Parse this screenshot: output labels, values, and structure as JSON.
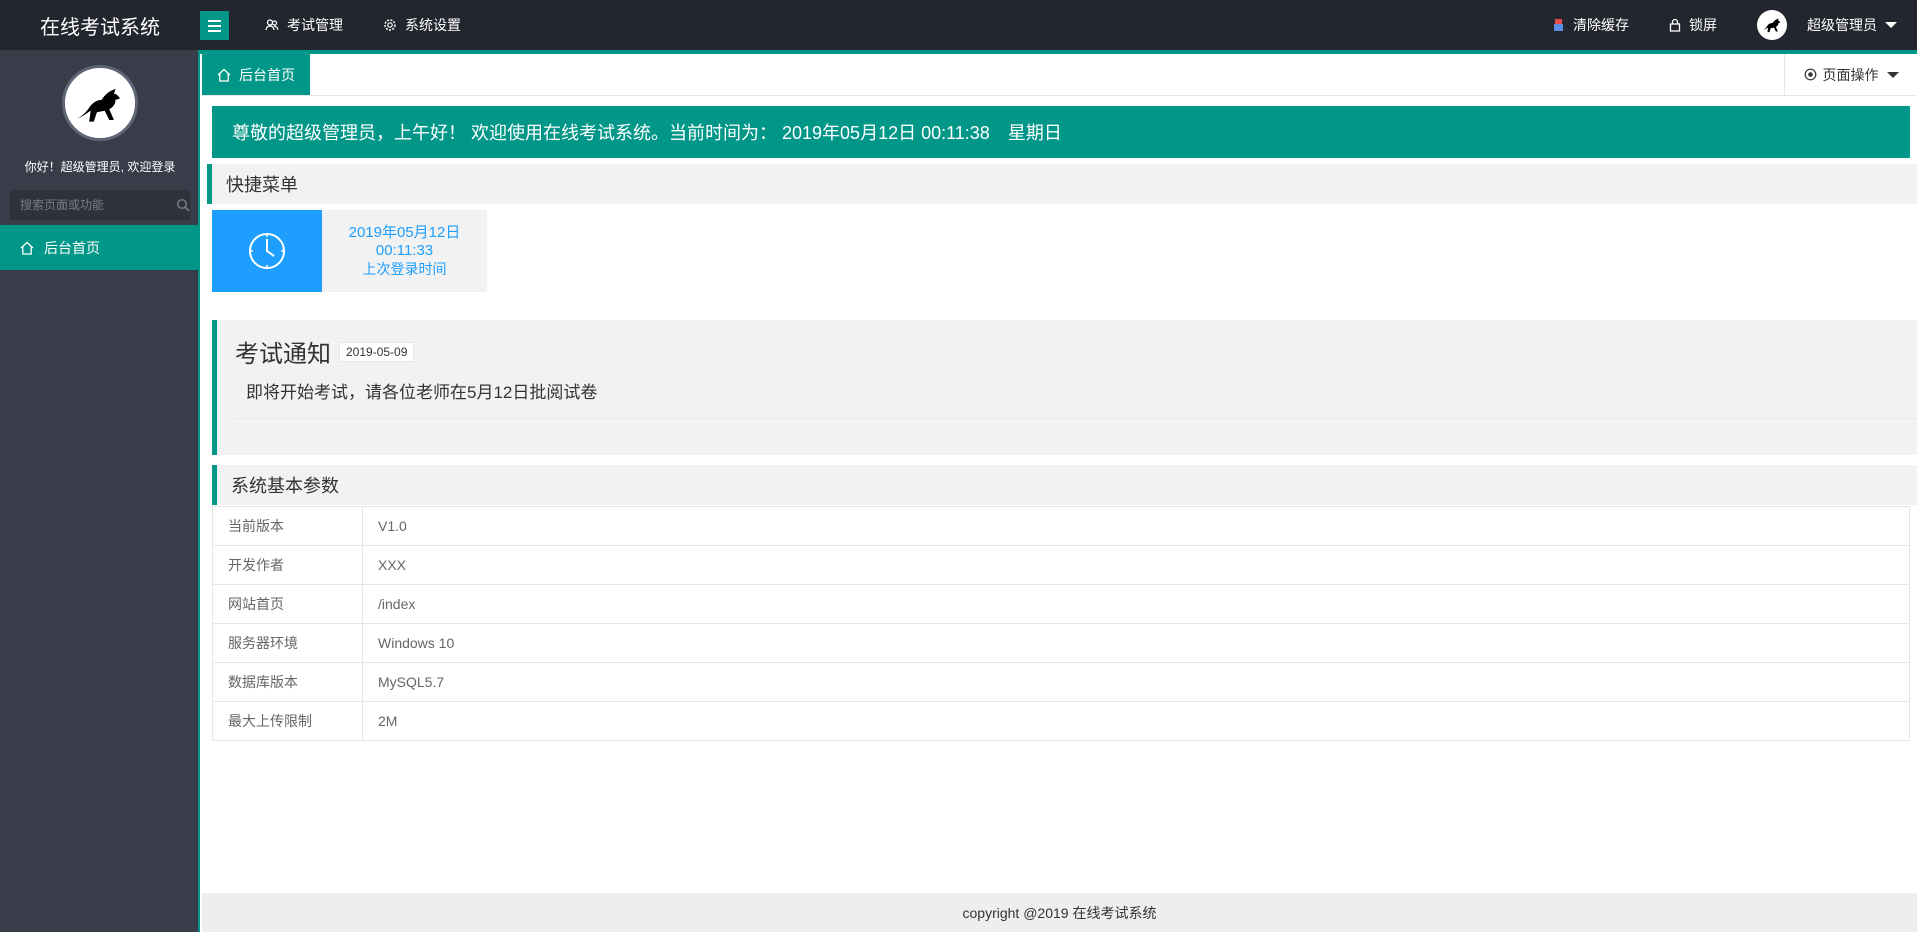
{
  "app": {
    "title": "在线考试系统"
  },
  "topnav": [
    {
      "label": "考试管理",
      "icon": "users-icon"
    },
    {
      "label": "系统设置",
      "icon": "gear-icon"
    }
  ],
  "topright": {
    "clear_cache": "清除缓存",
    "lock": "锁屏",
    "user": "超级管理员"
  },
  "sidebar": {
    "welcome": "你好！超级管理员, 欢迎登录",
    "search_placeholder": "搜索页面或功能",
    "menu": [
      {
        "label": "后台首页",
        "icon": "home-icon"
      }
    ]
  },
  "tabs": {
    "active": "后台首页",
    "page_ops": "页面操作"
  },
  "welcome_banner": "尊敬的超级管理员，上午好！ 欢迎使用在线考试系统。当前时间为： 2019年05月12日 00:11:38　星期日",
  "quick_menu": {
    "title": "快捷菜单",
    "card": {
      "date": "2019年05月12日",
      "time": "00:11:33",
      "label": "上次登录时间",
      "icon": "clock-icon"
    }
  },
  "notice": {
    "title": "考试通知",
    "date": "2019-05-09",
    "body": "即将开始考试，请各位老师在5月12日批阅试卷"
  },
  "params": {
    "title": "系统基本参数",
    "rows": [
      {
        "key": "当前版本",
        "value": "V1.0"
      },
      {
        "key": "开发作者",
        "value": "XXX"
      },
      {
        "key": "网站首页",
        "value": "/index"
      },
      {
        "key": "服务器环境",
        "value": "Windows 10"
      },
      {
        "key": "数据库版本",
        "value": "MySQL5.7"
      },
      {
        "key": "最大上传限制",
        "value": "2M"
      }
    ]
  },
  "footer": "copyright @2019 在线考试系统",
  "colors": {
    "accent": "#009688",
    "header": "#23262e",
    "sidebar": "#393d49",
    "blue": "#1e9fff"
  }
}
